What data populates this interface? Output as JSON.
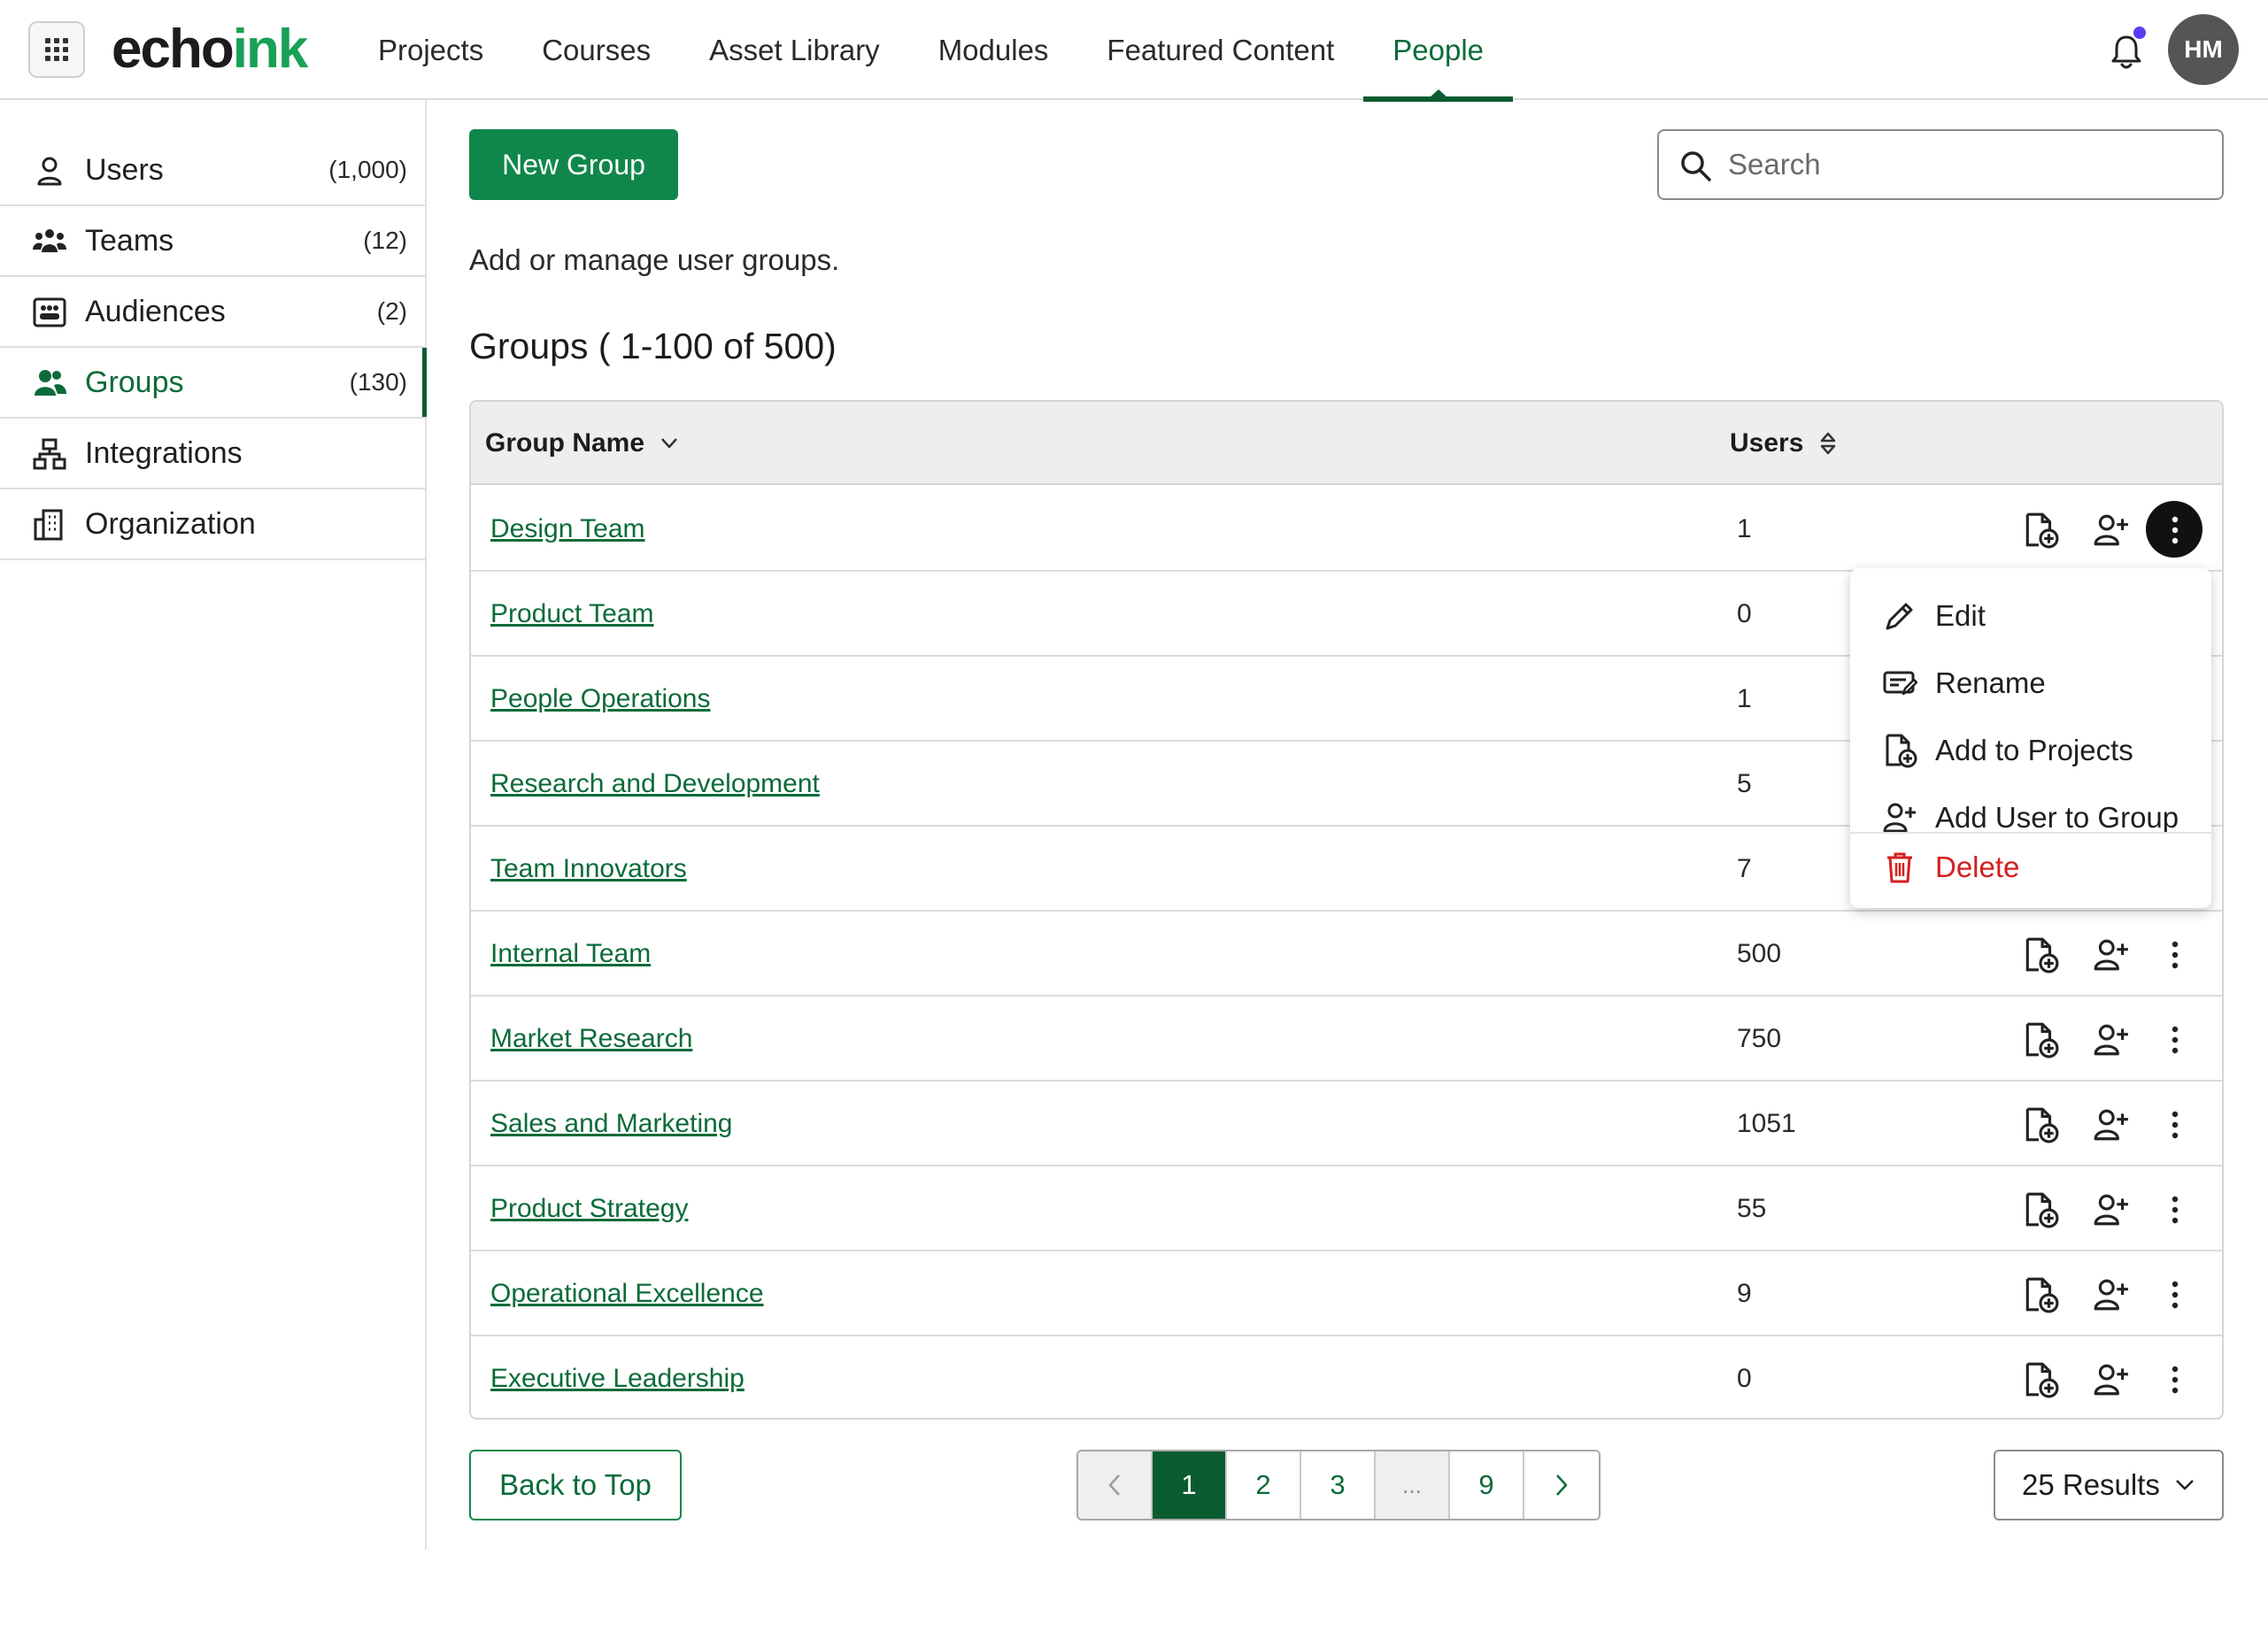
{
  "brand": {
    "part1": "echo",
    "part2": "ink"
  },
  "nav": {
    "items": [
      {
        "label": "Projects"
      },
      {
        "label": "Courses"
      },
      {
        "label": "Asset Library"
      },
      {
        "label": "Modules"
      },
      {
        "label": "Featured Content"
      },
      {
        "label": "People",
        "active": true
      }
    ]
  },
  "header": {
    "avatar_initials": "HM",
    "notification_icon": "bell-icon",
    "apps_icon": "grid-icon"
  },
  "sidebar": {
    "items": [
      {
        "label": "Users",
        "count": "(1,000)",
        "icon": "user-icon"
      },
      {
        "label": "Teams",
        "count": "(12)",
        "icon": "team-icon"
      },
      {
        "label": "Audiences",
        "count": "(2)",
        "icon": "audience-icon"
      },
      {
        "label": "Groups",
        "count": "(130)",
        "icon": "group-icon",
        "active": true
      },
      {
        "label": "Integrations",
        "count": "",
        "icon": "integrations-icon"
      },
      {
        "label": "Organization",
        "count": "",
        "icon": "organization-icon"
      }
    ]
  },
  "main": {
    "new_group_label": "New Group",
    "search_placeholder": "Search",
    "description": "Add or manage user groups.",
    "heading": "Groups ( 1-100 of 500)"
  },
  "table": {
    "columns": {
      "name": "Group Name",
      "users": "Users"
    },
    "rows": [
      {
        "name": "Design Team",
        "users": "1"
      },
      {
        "name": "Product Team",
        "users": "0"
      },
      {
        "name": "People Operations",
        "users": "1"
      },
      {
        "name": "Research and Development",
        "users": "5"
      },
      {
        "name": "Team Innovators",
        "users": "7"
      },
      {
        "name": "Internal Team",
        "users": "500"
      },
      {
        "name": "Market Research",
        "users": "750"
      },
      {
        "name": "Sales and Marketing",
        "users": "1051"
      },
      {
        "name": "Product Strategy",
        "users": "55"
      },
      {
        "name": "Operational Excellence",
        "users": "9"
      },
      {
        "name": "Executive Leadership",
        "users": "0"
      }
    ]
  },
  "menu": {
    "items": [
      {
        "label": "Edit",
        "icon": "pencil-icon"
      },
      {
        "label": "Rename",
        "icon": "rename-icon"
      },
      {
        "label": "Add to Projects",
        "icon": "file-add-icon"
      },
      {
        "label": "Add User to Group",
        "icon": "user-add-icon"
      },
      {
        "label": "Delete",
        "icon": "trash-icon"
      }
    ]
  },
  "footer": {
    "back_to_top": "Back to Top",
    "pages": [
      "1",
      "2",
      "3",
      "...",
      "9"
    ],
    "results_label": "25 Results"
  },
  "colors": {
    "brand_green": "#10874a",
    "dark_green": "#0b5b30",
    "danger": "#d51f1f"
  }
}
